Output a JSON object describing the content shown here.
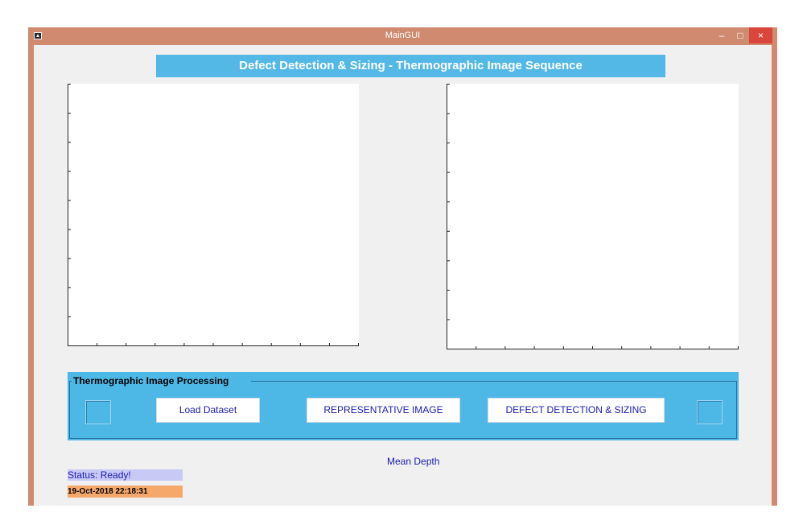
{
  "window": {
    "title": "MainGUI",
    "controls": {
      "minimize": "–",
      "maximize": "□",
      "close": "×"
    }
  },
  "banner": {
    "title": "Defect Detection & Sizing - Thermographic Image Sequence"
  },
  "axes": [
    {
      "name": "left-axes",
      "x_ticks": 11,
      "y_ticks": 10
    },
    {
      "name": "right-axes",
      "x_ticks": 11,
      "y_ticks": 10
    }
  ],
  "panel": {
    "title": "Thermographic Image Processing",
    "buttons": {
      "load": "Load Dataset",
      "representative": "REPRESENTATIVE IMAGE",
      "defect": "DEFECT DETECTION & SIZING"
    }
  },
  "labels": {
    "mean_depth": "Mean Depth",
    "status": "Status: Ready!",
    "datetime": "19-Oct-2018 22:18:31"
  },
  "colors": {
    "title_bar": "#cf8a70",
    "banner": "#54b8e6",
    "panel": "#4db8e6",
    "status_bg": "#c9c9f6",
    "datetime_bg": "#f6a86a",
    "button_text": "#1b1bb0"
  },
  "icons": [
    "app-icon",
    "minimize-icon",
    "maximize-icon",
    "close-icon"
  ]
}
